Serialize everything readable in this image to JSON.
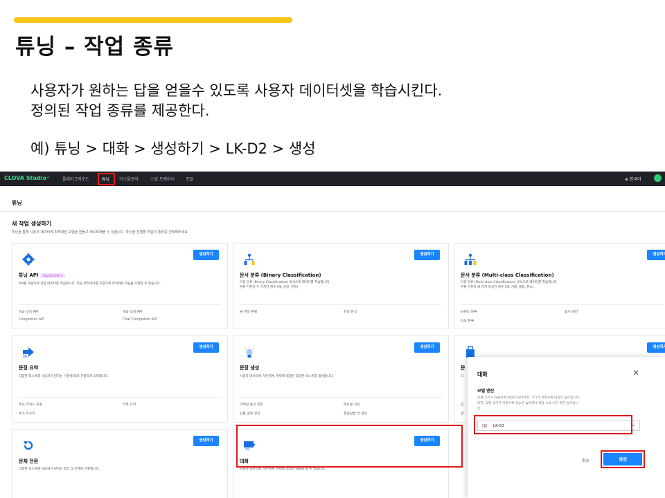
{
  "slide": {
    "title": "튜닝 – 작업 종류",
    "desc_line1": "사용자가 원하는 답을 얻을수 있도록 사용자 데이터셋을 학습시킨다.",
    "desc_line2": "정의된 작업 종류를 제공한다.",
    "desc_line3": "예) 튜닝 > 대화 > 생성하기 > LK-D2 > 생성"
  },
  "app": {
    "brand": "CLOVA Studio⁺",
    "nav": [
      "플레이그라운드",
      "튜닝",
      "익스플로러",
      "스킬 트레이너",
      "로컬"
    ],
    "lang": "⊕ 한국어"
  },
  "page": {
    "breadcrumb": "튜닝",
    "section_title": "새 작업 생성하기",
    "section_desc": "튜닝을 통해 사용자 데이터에 최적화된 모델을 만들고 테스트해볼 수 있습니다. 튜닝을 진행할 작업의 종류를 선택해주세요."
  },
  "create_label": "생성하기",
  "cards": {
    "tuning_api": {
      "title": "튜닝 API",
      "badge": "HyperCLOVA X",
      "desc": "API를 호출하여 직접 데이터를 학습합니다. 학습 파라미터를 조정하여 최적화된 학습을 수행할 수 있습니다.",
      "links": [
        "학습 생성 API",
        "학습 조회 API",
        "Completion API",
        "Chat Completion API"
      ]
    },
    "binary": {
      "title": "문서 분류 (Binary Classification)",
      "desc1": "이중 분류 (Binary Classification) 방식으로 데이터를 학습합니다.",
      "desc2": "분류 기준이 두 가지인 경우 (예, 긍정, 부정)",
      "links": [
        "긍 부정 판별",
        "감정 분석"
      ]
    },
    "multi": {
      "title": "문서 분류 (Multi-class Classification)",
      "desc1": "다중 분류 (Multi-class Classification) 방식으로 데이터를 학습합니다.",
      "desc2": "분류 기준이 세 가지 이상인 경우 (예, 기쁨, 슬픔, 분노)",
      "links": [
        "브랜드 분류",
        "음서 예언",
        "의도 분류"
      ]
    },
    "summary": {
      "title": "문장 요약",
      "desc": "다양한 텍스트를 사용자가 원하는 기준에 따라 간결하게 요약합니다.",
      "links": [
        "주요 키워드 추출",
        "리뷰 요약",
        "보고서 요약"
      ]
    },
    "generation": {
      "title": "문장 생성",
      "desc": "사용자 데이터에 기반하여, 주제에 적합한 다양한 텍스트를 생성합니다.",
      "links": [
        "마케팅 문구 정킹",
        "매뉴얼 작성",
        "상품 설명 생성",
        "질문답변 셋 생성"
      ]
    },
    "partial": {
      "title": "문",
      "desc": "다",
      "links": [
        "상",
        "광"
      ]
    },
    "transform": {
      "title": "문체 전환",
      "desc": "다양한 텍스트를 사용자가 원하는 형식 및 문체로 전환합니다."
    },
    "chat": {
      "title": "대화",
      "desc": "사용자 데이터에 기반하여, 주제에 적합한 대화를 할 수 있습니다."
    }
  },
  "modal": {
    "title": "대화",
    "close": "✕",
    "engine_label": "모델 엔진",
    "help1": "모델 크기가 작을수록 비용이 낮아지며, 크기가 커질수록 비용이 높아집니다.",
    "help2": "또한, 모델 크기가 커질수록 성능은 높아지나 작업 소요 시간 또한 늘어납니",
    "help3": "다.",
    "selected_engine": "LK-D2",
    "cancel": "취소",
    "submit": "생성"
  },
  "colors": {
    "accent_bar": "#f5c518",
    "primary": "#1a85ff",
    "highlight": "#e0191c",
    "navbar": "#1f2126",
    "brand": "#2ee08f"
  }
}
